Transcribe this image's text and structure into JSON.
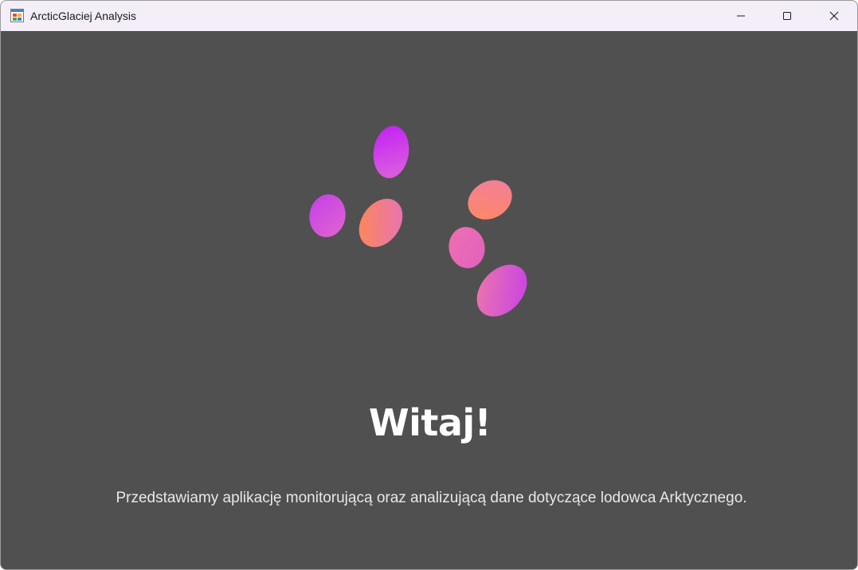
{
  "window": {
    "title": "ArcticGlaciej Analysis",
    "app_icon": "app-icon",
    "controls": {
      "minimize_icon": "minimize-icon",
      "maximize_icon": "maximize-icon",
      "close_icon": "close-icon"
    }
  },
  "main": {
    "welcome_heading": "Witaj!",
    "description": "Przedstawiamy aplikację monitorującą oraz analizującą dane dotyczące lodowca Arktycznego.",
    "loading_animation": {
      "icon": "loading-blobs-icon",
      "gradient_colors": [
        "#c832f0",
        "#e066c8",
        "#f57ea0",
        "#ff8a50"
      ]
    }
  },
  "colors": {
    "titlebar_bg": "#f3eef8",
    "client_bg": "#505050",
    "text_primary": "#ffffff"
  }
}
